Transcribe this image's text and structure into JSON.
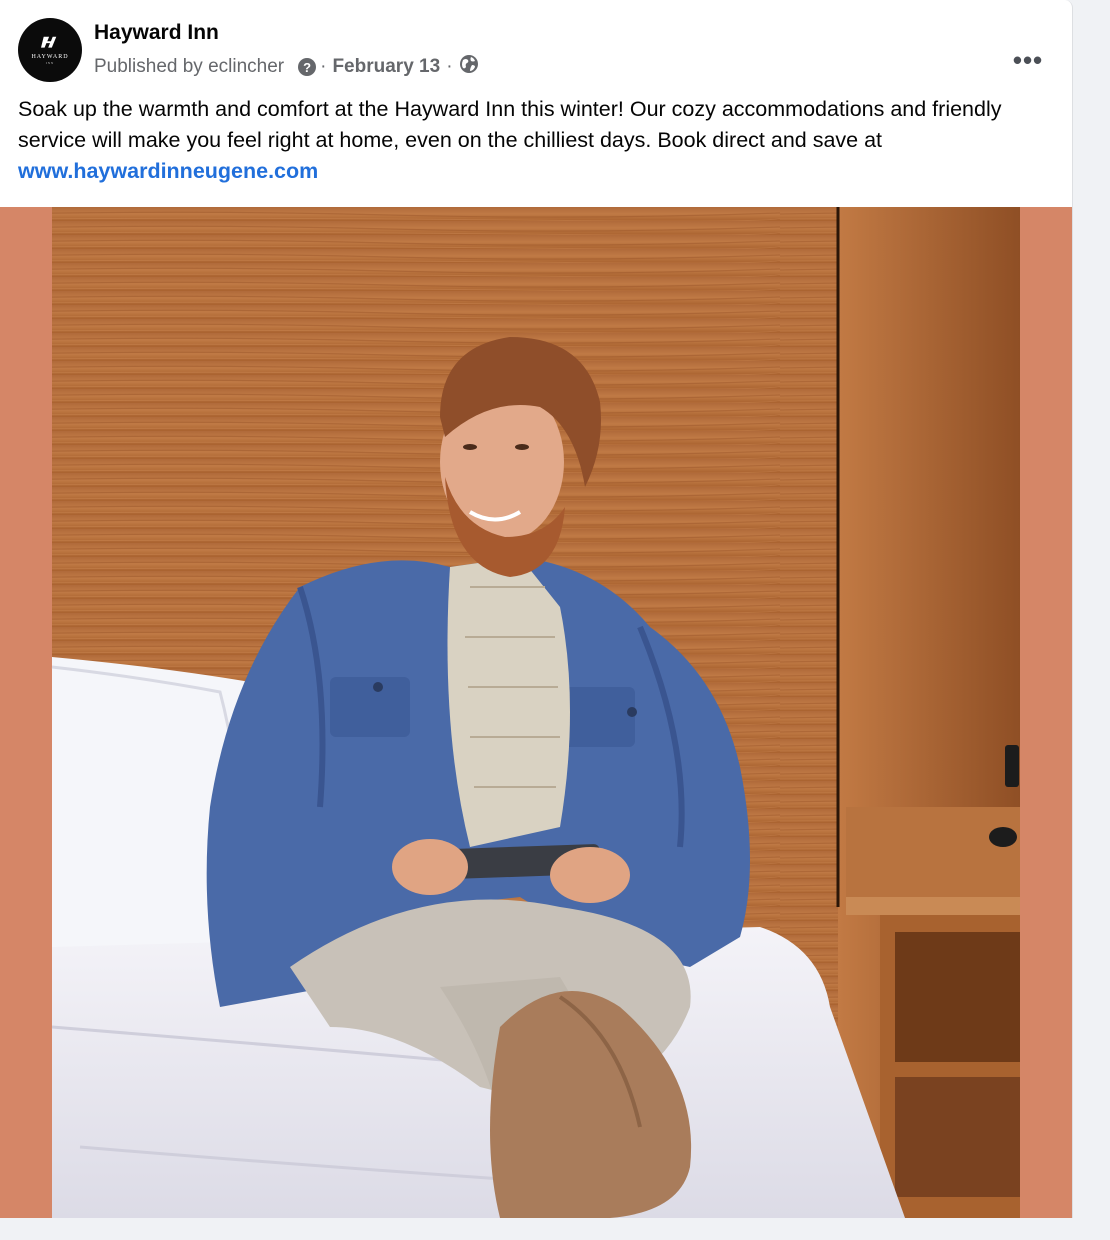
{
  "post": {
    "page_name": "Hayward Inn",
    "published_by": "Published by eclincher",
    "help_glyph": "?",
    "date": "February 13",
    "separator": "·",
    "more_glyph": "•••",
    "text": "Soak up the warmth and comfort at the Hayward Inn this winter! Our cozy accommodations and friendly service will make you feel right at home, even on the chilliest days. Book direct and save at ",
    "link_text": "www.haywardinneugene.com",
    "avatar_brand": "HAYWARD",
    "avatar_sub": "INN"
  },
  "icons": {
    "avatar": "hayward-logo-icon",
    "help": "question-mark-icon",
    "audience": "globe-icon",
    "menu": "more-options-icon"
  },
  "colors": {
    "link": "#216fdb",
    "frame": "#d58667",
    "jacket": "#4a6aa8"
  }
}
